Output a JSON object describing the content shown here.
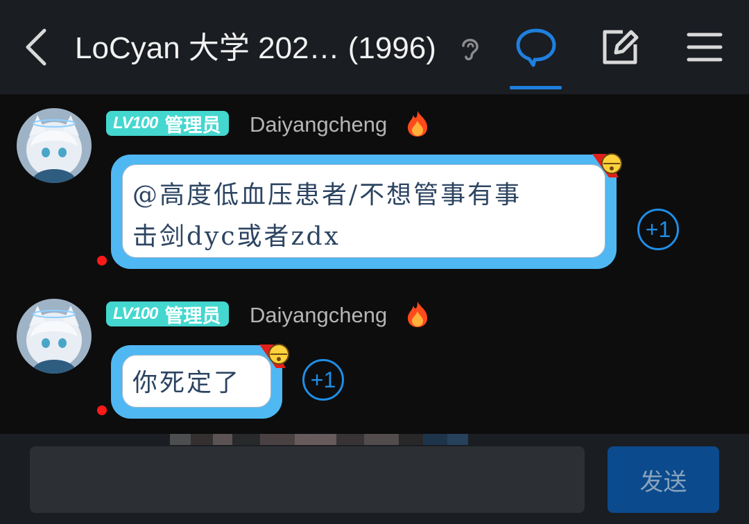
{
  "header": {
    "title": "LoCyan 大学 202… (1996)",
    "back_icon": "chevron-left-icon",
    "ear_icon": "ear-icon",
    "chat_icon": "chat-bubble-icon",
    "edit_icon": "edit-icon",
    "menu_icon": "hamburger-menu-icon",
    "accent": "#1f7fde"
  },
  "messages": [
    {
      "level": "LV100",
      "role": "管理员",
      "username": "Daiyangcheng",
      "line1": "@高度低血压患者/不想管事有事",
      "line2": "击剑dyc或者zdx",
      "plus": "+1"
    },
    {
      "level": "LV100",
      "role": "管理员",
      "username": "Daiyangcheng",
      "line1": "你死定了",
      "plus": "+1"
    }
  ],
  "input": {
    "value": "",
    "send_label": "发送"
  },
  "colors": {
    "badge": "#44d7cf",
    "bubble_border": "#4fb8f3",
    "plus": "#1f8ee6",
    "send_button": "#0b4a8c"
  }
}
